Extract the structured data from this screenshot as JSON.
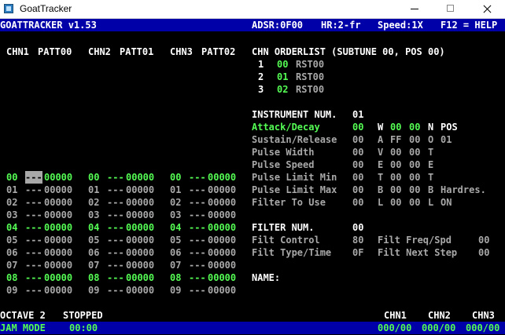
{
  "window": {
    "title": "GoatTracker"
  },
  "status_bar": {
    "app": "GOATTRACKER v1.53",
    "adsr": "ADSR:0F00",
    "hr": "HR:2-fr",
    "speed": "Speed:1X",
    "help": "F12 = HELP"
  },
  "channels": [
    {
      "chn": "CHN1",
      "patt": "PATT00"
    },
    {
      "chn": "CHN2",
      "patt": "PATT01"
    },
    {
      "chn": "CHN3",
      "patt": "PATT02"
    }
  ],
  "pattern_rows": [
    {
      "idx": "00",
      "note": "---",
      "data": "00000"
    },
    {
      "idx": "01",
      "note": "---",
      "data": "00000"
    },
    {
      "idx": "02",
      "note": "---",
      "data": "00000"
    },
    {
      "idx": "03",
      "note": "---",
      "data": "00000"
    },
    {
      "idx": "04",
      "note": "---",
      "data": "00000"
    },
    {
      "idx": "05",
      "note": "---",
      "data": "00000"
    },
    {
      "idx": "06",
      "note": "---",
      "data": "00000"
    },
    {
      "idx": "07",
      "note": "---",
      "data": "00000"
    },
    {
      "idx": "08",
      "note": "---",
      "data": "00000"
    },
    {
      "idx": "09",
      "note": "---",
      "data": "00000"
    }
  ],
  "orderlist": {
    "header": "CHN ORDERLIST (SUBTUNE 00, POS 00)",
    "rows": [
      {
        "chn": "1",
        "pos": "00",
        "cmd": "RST00"
      },
      {
        "chn": "2",
        "pos": "01",
        "cmd": "RST00"
      },
      {
        "chn": "3",
        "pos": "02",
        "cmd": "RST00"
      }
    ]
  },
  "instrument": {
    "label": "INSTRUMENT NUM.",
    "num": "01",
    "params": [
      {
        "name": "Attack/Decay",
        "val": "00"
      },
      {
        "name": "Sustain/Release",
        "val": "00"
      },
      {
        "name": "Pulse Width",
        "val": "00"
      },
      {
        "name": "Pulse Speed",
        "val": "00"
      },
      {
        "name": "Pulse Limit Min",
        "val": "00"
      },
      {
        "name": "Pulse Limit Max",
        "val": "00"
      },
      {
        "name": "Filter To Use",
        "val": "00"
      }
    ],
    "tables": [
      {
        "c1": "W",
        "v1": "00",
        "v2": "00",
        "c2": "N",
        "info": "POS"
      },
      {
        "c1": "A",
        "v1": "FF",
        "v2": "00",
        "c2": "O",
        "info": "01"
      },
      {
        "c1": "V",
        "v1": "00",
        "v2": "00",
        "c2": "T",
        "info": ""
      },
      {
        "c1": "E",
        "v1": "00",
        "v2": "00",
        "c2": "E",
        "info": ""
      },
      {
        "c1": "T",
        "v1": "00",
        "v2": "00",
        "c2": "T",
        "info": ""
      },
      {
        "c1": "B",
        "v1": "00",
        "v2": "00",
        "c2": "B",
        "info": "Hardres."
      },
      {
        "c1": "L",
        "v1": "00",
        "v2": "00",
        "c2": "L",
        "info": "ON"
      }
    ]
  },
  "filter": {
    "label": "FILTER NUM.",
    "num": "00",
    "control": {
      "name": "Filt Control",
      "val": "80"
    },
    "type": {
      "name": "Filt Type/Time",
      "val": "0F"
    },
    "freq": {
      "name": "Filt Freq/Spd",
      "val": "00"
    },
    "next": {
      "name": "Filt Next Step",
      "val": "00"
    }
  },
  "name_label": "NAME:",
  "bottom": {
    "octave": "OCTAVE 2",
    "state": "STOPPED",
    "mode": "JAM MODE",
    "time": "00:00",
    "chn_labels": [
      "CHN1",
      "CHN2",
      "CHN3"
    ],
    "chn_values": [
      "000/00",
      "000/00",
      "000/00"
    ]
  }
}
